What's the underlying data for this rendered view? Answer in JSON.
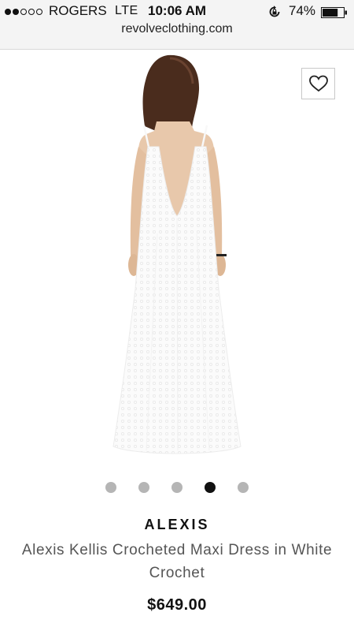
{
  "status_bar": {
    "signal_bars_filled": 2,
    "signal_bars_total": 5,
    "carrier": "ROGERS",
    "network": "LTE",
    "time": "10:06 AM",
    "battery_percent": "74%",
    "battery_level": 0.74
  },
  "browser": {
    "url": "revolveclothing.com"
  },
  "product": {
    "image_icon": "dress-photo",
    "wishlist_icon": "heart-outline-icon",
    "carousel": {
      "count": 5,
      "active_index": 3
    },
    "brand": "ALEXIS",
    "name": "Alexis Kellis Crocheted Maxi Dress in White Crochet",
    "price": "$649.00"
  },
  "colors": {
    "status_bg": "#f4f4f4",
    "carousel_active": "#111111",
    "carousel_inactive": "#b5b5b5",
    "name_text": "#555555"
  }
}
